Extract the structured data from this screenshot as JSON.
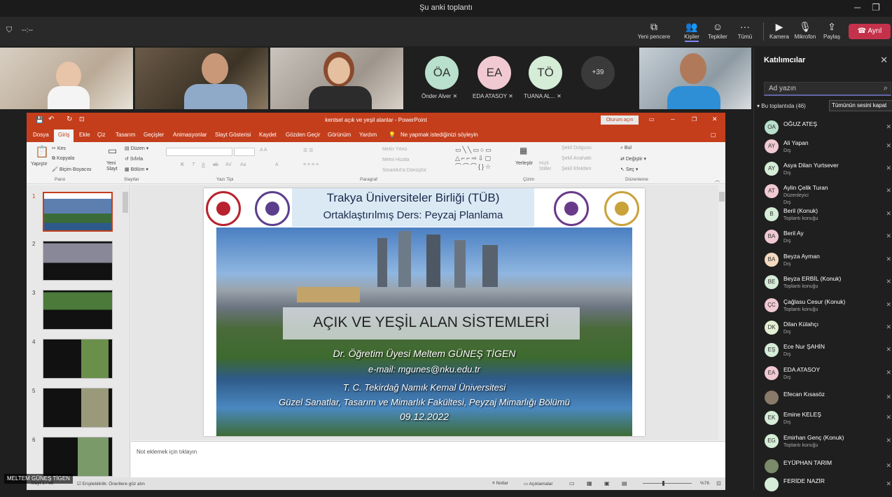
{
  "window": {
    "title": "Şu anki toplantı"
  },
  "top_left": {
    "timer": "--:--"
  },
  "toolbar": {
    "new_window": "Yeni pencere",
    "people": "Kişiler",
    "reactions": "Tepkiler",
    "more": "Tümü",
    "camera": "Kamera",
    "mic": "Mikrofon",
    "share": "Paylaş",
    "leave": "Ayrıl"
  },
  "video": {
    "avatars": [
      {
        "initials": "ÖA",
        "name": "Önder Alver",
        "color": "#b8e0cc"
      },
      {
        "initials": "EA",
        "name": "EDA ATASOY",
        "color": "#f1c9d3"
      },
      {
        "initials": "TÖ",
        "name": "TUANA AL...",
        "color": "#d5ecd7"
      }
    ],
    "overflow": "+39"
  },
  "participants_panel": {
    "title": "Katılımcılar",
    "search_placeholder": "Ad yazın",
    "in_meeting": "Bu toplantıda (46)",
    "mute_all": "Tümünün sesini kapat",
    "people": [
      {
        "initials": "OA",
        "name": "OĞUZ ATEŞ",
        "sub": "",
        "color": "#b8e0cc"
      },
      {
        "initials": "AY",
        "name": "Ali Yapan",
        "sub": "Dış",
        "color": "#f1c9d3"
      },
      {
        "initials": "AY",
        "name": "Asya Dilan Yurtsever",
        "sub": "Dış",
        "color": "#d5ecd7"
      },
      {
        "initials": "AT",
        "name": "Aylin Çelik Turan",
        "sub": "Düzenleyici",
        "sub2": "Dış",
        "color": "#f1c9d3"
      },
      {
        "initials": "B",
        "name": "Beril (Konuk)",
        "sub": "Toplantı konuğu",
        "color": "#d5ecd7"
      },
      {
        "initials": "BA",
        "name": "Beril Ay",
        "sub": "Dış",
        "color": "#f1c9d3"
      },
      {
        "initials": "BA",
        "name": "Beyza Ayman",
        "sub": "Dış",
        "color": "#f3d9c0"
      },
      {
        "initials": "BE",
        "name": "Beyza ERBİL (Konuk)",
        "sub": "Toplantı konuğu",
        "color": "#d5ecd7"
      },
      {
        "initials": "ÇC",
        "name": "Çağlasu Cesur (Konuk)",
        "sub": "Toplantı konuğu",
        "color": "#f1c9d3"
      },
      {
        "initials": "DK",
        "name": "Dilan Külahçı",
        "sub": "Dış",
        "color": "#e2efd2"
      },
      {
        "initials": "EŞ",
        "name": "Ece Nur ŞAHİN",
        "sub": "Dış",
        "color": "#d5ecd7"
      },
      {
        "initials": "EA",
        "name": "EDA ATASOY",
        "sub": "Dış",
        "color": "#f1c9d3"
      },
      {
        "initials": "",
        "name": "Efecan Kısasöz",
        "sub": "",
        "color": "#8a7a6a"
      },
      {
        "initials": "EK",
        "name": "Emine KELEŞ",
        "sub": "Dış",
        "color": "#d5ecd7"
      },
      {
        "initials": "EG",
        "name": "Emirhan Genç (Konuk)",
        "sub": "Toplantı konuğu",
        "color": "#d5ecd7"
      },
      {
        "initials": "",
        "name": "EYÜPHAN TARIM",
        "sub": "",
        "color": "#7a8a6a"
      },
      {
        "initials": "",
        "name": "FERİDE NAZİR",
        "sub": "",
        "color": "#d5ecd7"
      }
    ]
  },
  "powerpoint": {
    "title": "kentsel açık ve yeşil alanlar - PowerPoint",
    "signin": "Oturum açın",
    "tabs": [
      "Dosya",
      "Giriş",
      "Ekle",
      "Çiz",
      "Tasarım",
      "Geçişler",
      "Animasyonlar",
      "Slayt Gösterisi",
      "Kaydet",
      "Gözden Geçir",
      "Görünüm",
      "Yardım"
    ],
    "tell_me": "Ne yapmak istediğinizi söyleyin",
    "ribbon": {
      "paste": "Yapıştır",
      "cut": "Kes",
      "copy": "Kopyala",
      "format_painter": "Biçim Boyacısı",
      "new_slide": "Yeni Slayt",
      "layout": "Düzen",
      "reset": "Sıfırla",
      "section": "Bölüm",
      "text_direction": "Metin Yönü",
      "align_text": "Metni Hizala",
      "smartart": "SmartArt'a Dönüştür",
      "arrange": "Yerleştir",
      "quick_styles": "Hızlı Stiller",
      "shape_fill": "Şekil Dolgusu",
      "shape_outline": "Şekil Anahattı",
      "shape_effects": "Şekil Efektleri",
      "find": "Bul",
      "replace": "Değiştir",
      "select": "Seç",
      "groups": {
        "clipboard": "Pano",
        "slides": "Slaytlar",
        "font": "Yazı Tipi",
        "paragraph": "Paragraf",
        "drawing": "Çizim",
        "editing": "Düzenleme"
      }
    },
    "slide": {
      "line1": "Trakya Üniversiteler Birliği (TÜB)",
      "line2": "Ortaklaştırılmış Ders: Peyzaj Planlama",
      "main_title": "AÇIK VE YEŞİL ALAN SİSTEMLERİ",
      "author": "Dr. Öğretim Üyesi Meltem GÜNEŞ TİGEN",
      "email": "e-mail: mgunes@nku.edu.tr",
      "university": "T. C. Tekirdağ Namık Kemal Üniversitesi",
      "faculty": "Güzel Sanatlar, Tasarım ve Mimarlık Fakültesi, Peyzaj Mimarlığı Bölümü",
      "date": "09.12.2022"
    },
    "thumbnails": [
      "1",
      "2",
      "3",
      "4",
      "5",
      "6"
    ],
    "notes_placeholder": "Not eklemek için tıklayın",
    "status": {
      "slide": "Slayt 1 / 66",
      "accessibility": "Erişilebilirlik: Önerilere göz atın",
      "notes": "Notlar",
      "comments": "Açıklamalar",
      "zoom": "%76"
    }
  },
  "presenter": "MELTEM GÜNEŞ TİGEN"
}
